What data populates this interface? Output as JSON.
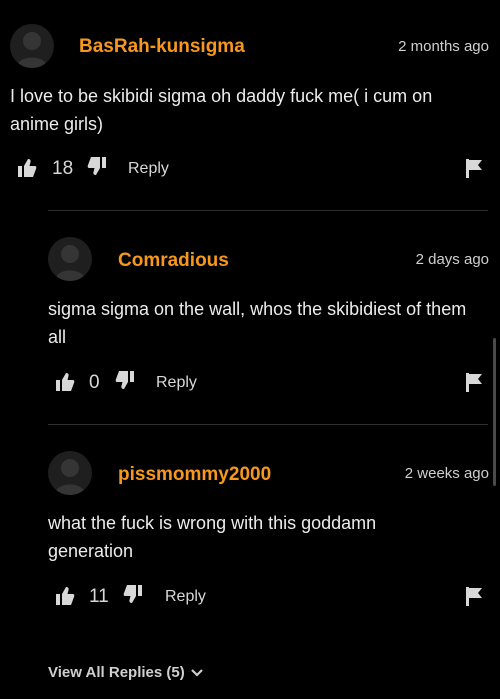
{
  "comments": [
    {
      "username": "BasRah-kunsigma",
      "timestamp": "2 months ago",
      "text": "I love to be skibidi sigma oh daddy fuck me( i cum on anime girls)",
      "likes": "18",
      "reply_label": "Reply"
    },
    {
      "username": "Comradious",
      "timestamp": "2 days ago",
      "text": "sigma sigma on the wall, whos the skibidiest of them all",
      "likes": "0",
      "reply_label": "Reply"
    },
    {
      "username": "pissmommy2000",
      "timestamp": "2 weeks ago",
      "text": "what the fuck is wrong with this goddamn generation",
      "likes": "11",
      "reply_label": "Reply"
    }
  ],
  "view_all_replies": "View All Replies (5)",
  "colors": {
    "username": "#f7971d",
    "background": "#000000"
  },
  "icons": [
    "avatar-placeholder-icon",
    "thumbs-up-icon",
    "thumbs-down-icon",
    "flag-icon",
    "chevron-down-icon"
  ]
}
